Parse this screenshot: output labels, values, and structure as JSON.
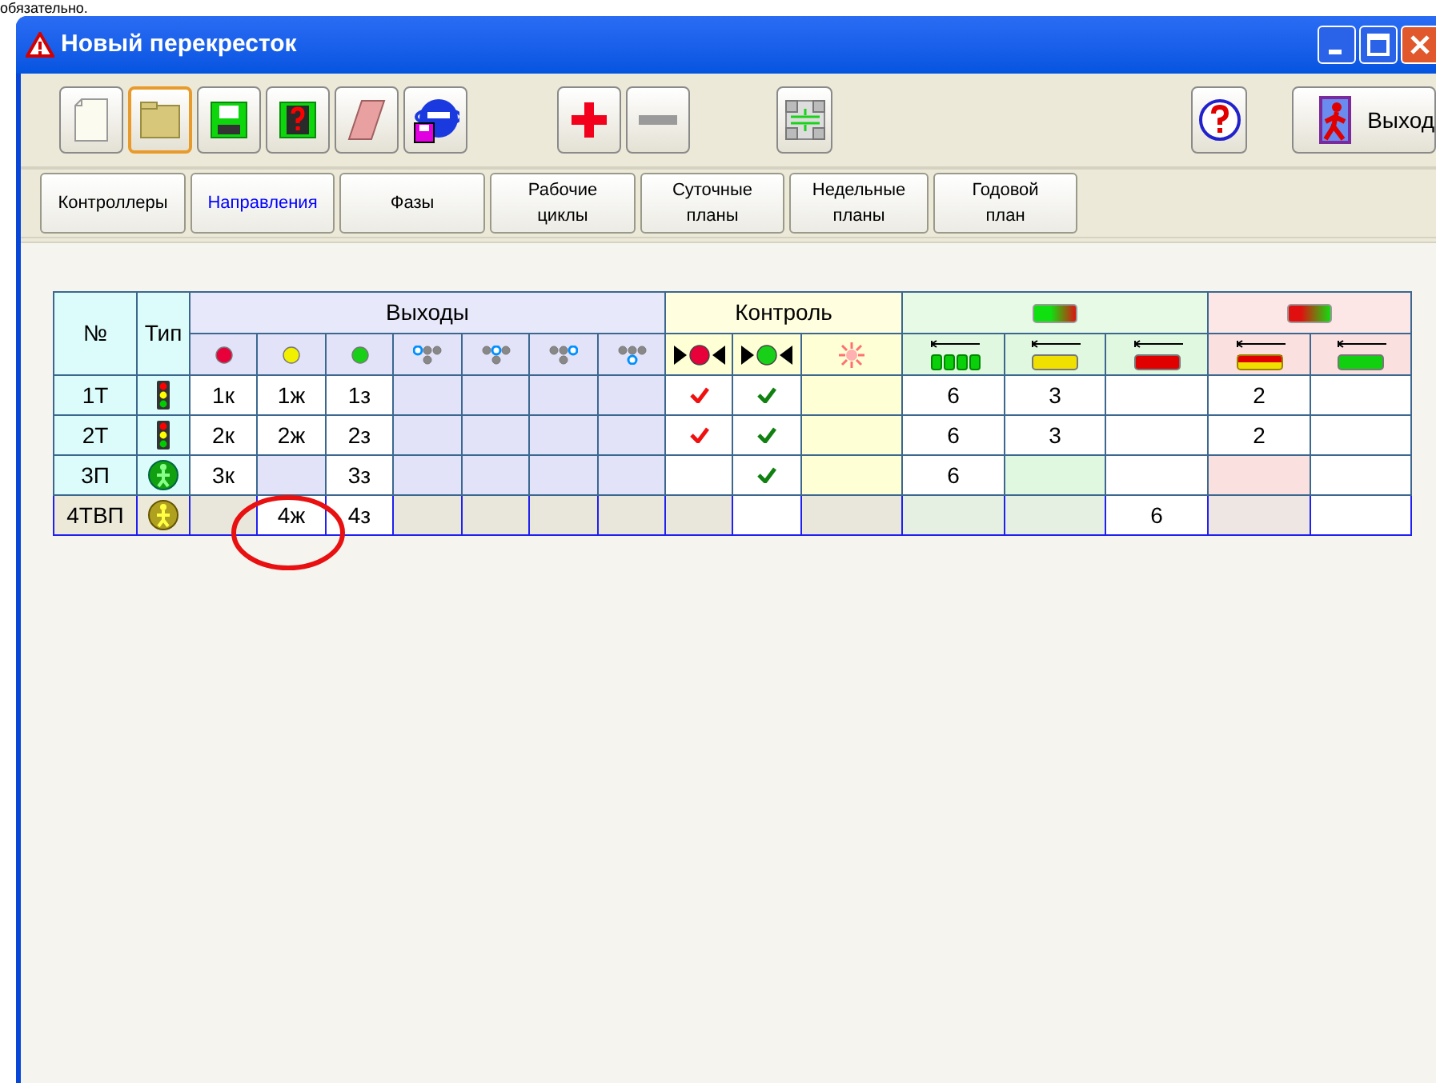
{
  "top_text": "обязательно.",
  "window": {
    "title": "Новый перекресток"
  },
  "toolbar": {
    "exit_label": "Выход"
  },
  "tabs": [
    {
      "lines": [
        "Контроллеры"
      ],
      "selected": false
    },
    {
      "lines": [
        "Направления"
      ],
      "selected": true
    },
    {
      "lines": [
        "Фазы"
      ],
      "selected": false
    },
    {
      "lines": [
        "Рабочие",
        "циклы"
      ],
      "selected": false
    },
    {
      "lines": [
        "Суточные",
        "планы"
      ],
      "selected": false
    },
    {
      "lines": [
        "Недельные",
        "планы"
      ],
      "selected": false
    },
    {
      "lines": [
        "Годовой",
        "план"
      ],
      "selected": false
    }
  ],
  "table": {
    "headers": {
      "number": "№",
      "type": "Тип",
      "outputs": "Выходы",
      "control": "Контроль"
    },
    "rows": [
      {
        "number": "1Т",
        "kind": "traffic-light",
        "selected": false,
        "cells": [
          {
            "text": "1к",
            "enabled": true
          },
          {
            "text": "1ж",
            "enabled": true
          },
          {
            "text": "1з",
            "enabled": true
          },
          {
            "enabled": false
          },
          {
            "enabled": false
          },
          {
            "enabled": false
          },
          {
            "enabled": false
          },
          {
            "checked": true,
            "enabled": true
          },
          {
            "checked": true,
            "enabled": true
          },
          {
            "enabled": false
          },
          {
            "text": "6",
            "enabled": true
          },
          {
            "text": "3",
            "enabled": true
          },
          {
            "enabled": true
          },
          {
            "text": "2",
            "enabled": true
          },
          {
            "enabled": true
          }
        ]
      },
      {
        "number": "2Т",
        "kind": "traffic-light",
        "selected": false,
        "cells": [
          {
            "text": "2к",
            "enabled": true
          },
          {
            "text": "2ж",
            "enabled": true
          },
          {
            "text": "2з",
            "enabled": true
          },
          {
            "enabled": false
          },
          {
            "enabled": false
          },
          {
            "enabled": false
          },
          {
            "enabled": false
          },
          {
            "checked": true,
            "enabled": true
          },
          {
            "checked": true,
            "enabled": true
          },
          {
            "enabled": false
          },
          {
            "text": "6",
            "enabled": true
          },
          {
            "text": "3",
            "enabled": true
          },
          {
            "enabled": true
          },
          {
            "text": "2",
            "enabled": true
          },
          {
            "enabled": true
          }
        ]
      },
      {
        "number": "3П",
        "kind": "pedestrian-green",
        "selected": false,
        "cells": [
          {
            "text": "3к",
            "enabled": true
          },
          {
            "enabled": false
          },
          {
            "text": "3з",
            "enabled": true
          },
          {
            "enabled": false
          },
          {
            "enabled": false
          },
          {
            "enabled": false
          },
          {
            "enabled": false
          },
          {
            "checked": false,
            "enabled": true
          },
          {
            "checked": true,
            "enabled": true
          },
          {
            "enabled": false
          },
          {
            "text": "6",
            "enabled": true
          },
          {
            "enabled": false
          },
          {
            "enabled": true
          },
          {
            "enabled": false
          },
          {
            "enabled": true
          }
        ]
      },
      {
        "number": "4ТВП",
        "kind": "pedestrian-yellow",
        "selected": true,
        "cells": [
          {
            "enabled": false
          },
          {
            "text": "4ж",
            "enabled": true
          },
          {
            "text": "4з",
            "enabled": true
          },
          {
            "enabled": false
          },
          {
            "enabled": false
          },
          {
            "enabled": false
          },
          {
            "enabled": false
          },
          {
            "enabled": false
          },
          {
            "checked": false,
            "enabled": true
          },
          {
            "enabled": false
          },
          {
            "enabled": false
          },
          {
            "enabled": false
          },
          {
            "text": "6",
            "enabled": true
          },
          {
            "enabled": false
          },
          {
            "enabled": true
          }
        ]
      }
    ]
  }
}
